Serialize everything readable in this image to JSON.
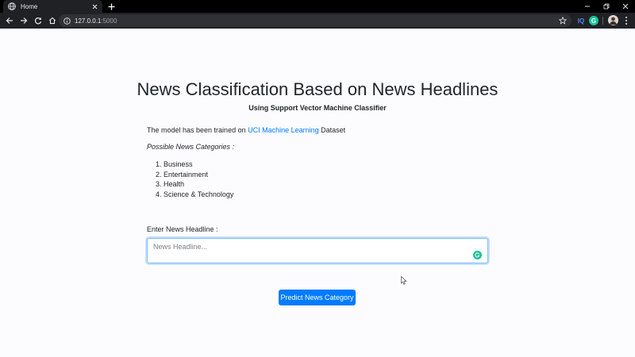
{
  "browser": {
    "tab_title": "Home",
    "url_host": "127.0.0.1",
    "url_port": ":5000",
    "extensions": {
      "iq_label": "IQ",
      "grammarly_label": "G"
    }
  },
  "page": {
    "title": "News Classification Based on News Headlines",
    "subtitle": "Using Support Vector Machine Classifier",
    "intro_prefix": "The model has been trained on ",
    "intro_link": "UCI Machine Learning",
    "intro_suffix": " Dataset",
    "categories_heading": "Possible News Categories :",
    "categories": [
      {
        "num": "1.",
        "label": "Business"
      },
      {
        "num": "2.",
        "label": "Entertainment"
      },
      {
        "num": "3.",
        "label": "Health"
      },
      {
        "num": "4.",
        "label": "Science & Technology"
      }
    ],
    "input_label": "Enter News Headline :",
    "input_placeholder": "News Headline...",
    "input_value": "",
    "button_label": "Predict News Category"
  },
  "colors": {
    "accent": "#007bff",
    "link": "#007bff",
    "grammarly": "#15c39a",
    "chrome_bg": "#202124"
  }
}
